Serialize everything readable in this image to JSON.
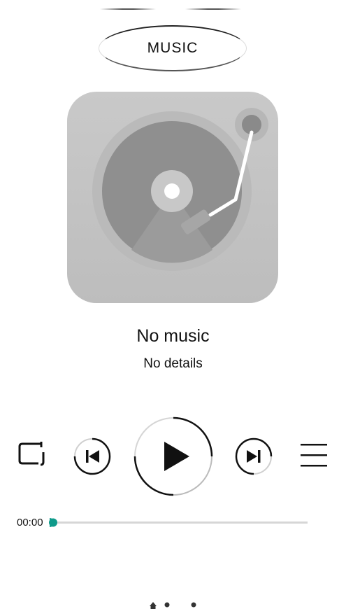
{
  "header": {
    "title": "MUSIC"
  },
  "track": {
    "title": "No music",
    "details": "No details"
  },
  "player": {
    "current_time": "00:00",
    "progress": 0,
    "accent_color": "#0e9a8a",
    "controls": [
      "repeat-icon",
      "previous-icon",
      "play-icon",
      "next-icon",
      "playlist-icon"
    ]
  },
  "pager": {
    "pages": 3,
    "current": 0,
    "icons": [
      "home-icon",
      "page-dot",
      "page-dot"
    ]
  }
}
